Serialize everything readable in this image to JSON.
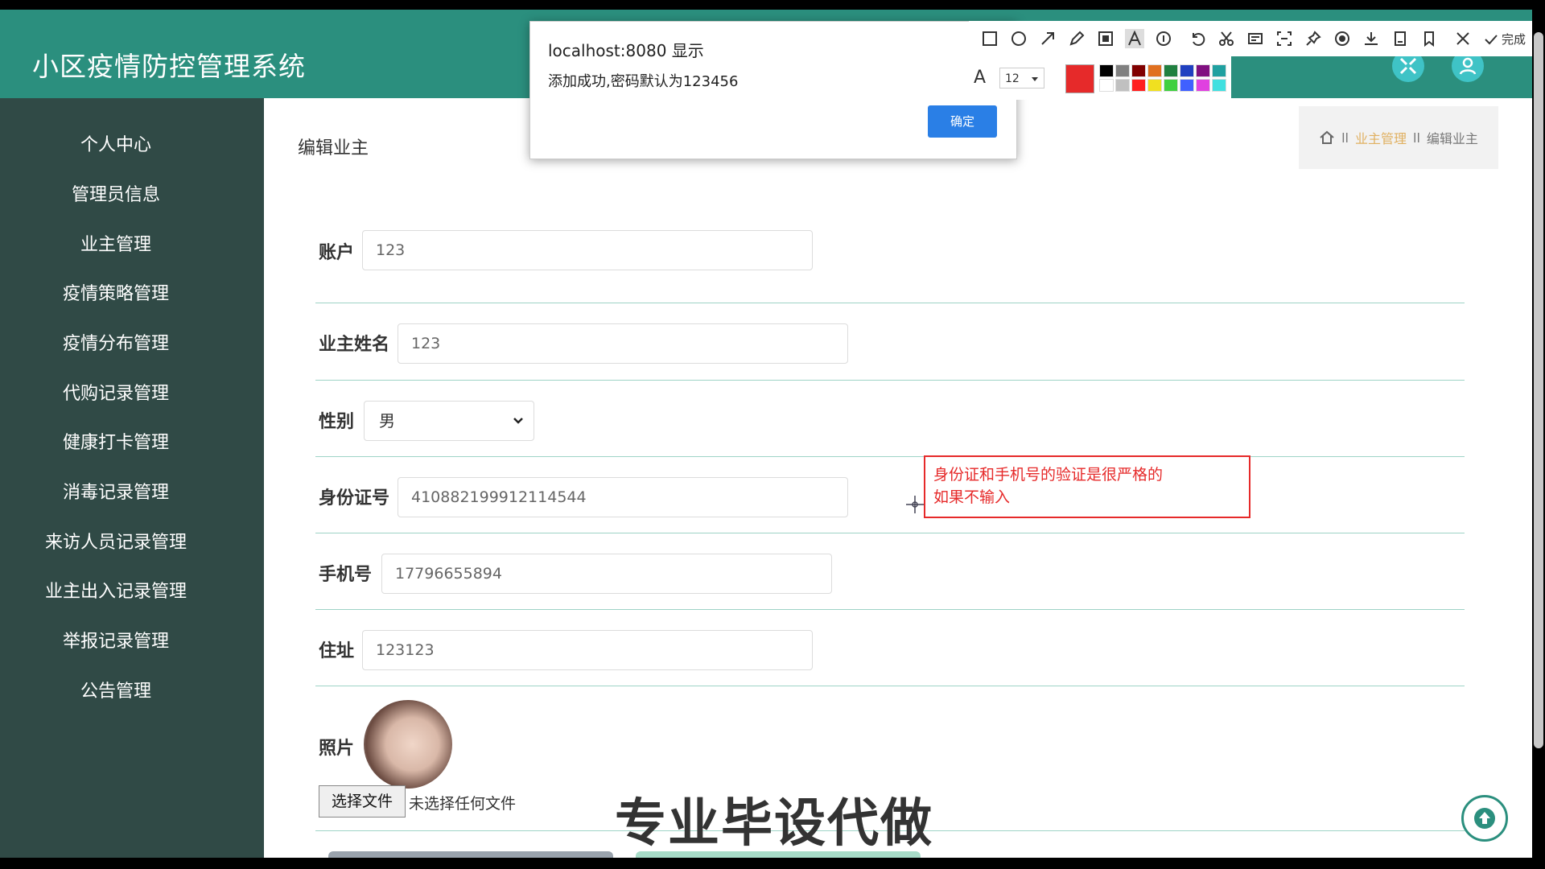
{
  "app": {
    "title": "小区疫情防控管理系统"
  },
  "sidebar": {
    "items": [
      {
        "label": "个人中心"
      },
      {
        "label": "管理员信息"
      },
      {
        "label": "业主管理"
      },
      {
        "label": "疫情策略管理"
      },
      {
        "label": "疫情分布管理"
      },
      {
        "label": "代购记录管理"
      },
      {
        "label": "健康打卡管理"
      },
      {
        "label": "消毒记录管理"
      },
      {
        "label": "来访人员记录管理"
      },
      {
        "label": "业主出入记录管理"
      },
      {
        "label": "举报记录管理"
      },
      {
        "label": "公告管理"
      }
    ]
  },
  "page": {
    "title": "编辑业主",
    "breadcrumb": {
      "separator": "ll",
      "parent": "业主管理",
      "current": "编辑业主"
    }
  },
  "form": {
    "account": {
      "label": "账户",
      "value": "123"
    },
    "owner_name": {
      "label": "业主姓名",
      "value": "123"
    },
    "gender": {
      "label": "性别",
      "value": "男"
    },
    "id_number": {
      "label": "身份证号",
      "value": "410882199912114544"
    },
    "phone": {
      "label": "手机号",
      "value": "17796655894"
    },
    "address": {
      "label": "住址",
      "value": "123123"
    },
    "photo": {
      "label": "照片",
      "choose_file": "选择文件",
      "no_file": "未选择任何文件"
    }
  },
  "annotation": {
    "line1": "身份证和手机号的验证是很严格的",
    "line2": "如果不输入"
  },
  "watermark": "专业毕设代做",
  "dialog": {
    "title": "localhost:8080 显示",
    "message": "添加成功,密码默认为123456",
    "ok": "确定"
  },
  "toolbar": {
    "font_size": "12",
    "done": "完成",
    "font_icon_label": "A",
    "accent_color": "#e62a2a",
    "palette": [
      "#000000",
      "#808080",
      "#800000",
      "#e07020",
      "#208040",
      "#2040c0",
      "#801080",
      "#20a0a0",
      "#ffffff",
      "#c0c0c0",
      "#ff2020",
      "#f0e020",
      "#40d040",
      "#4060ff",
      "#e040e0",
      "#40e0e0"
    ]
  },
  "colors": {
    "header": "#2b8f7e",
    "sidebar": "#304a46"
  }
}
